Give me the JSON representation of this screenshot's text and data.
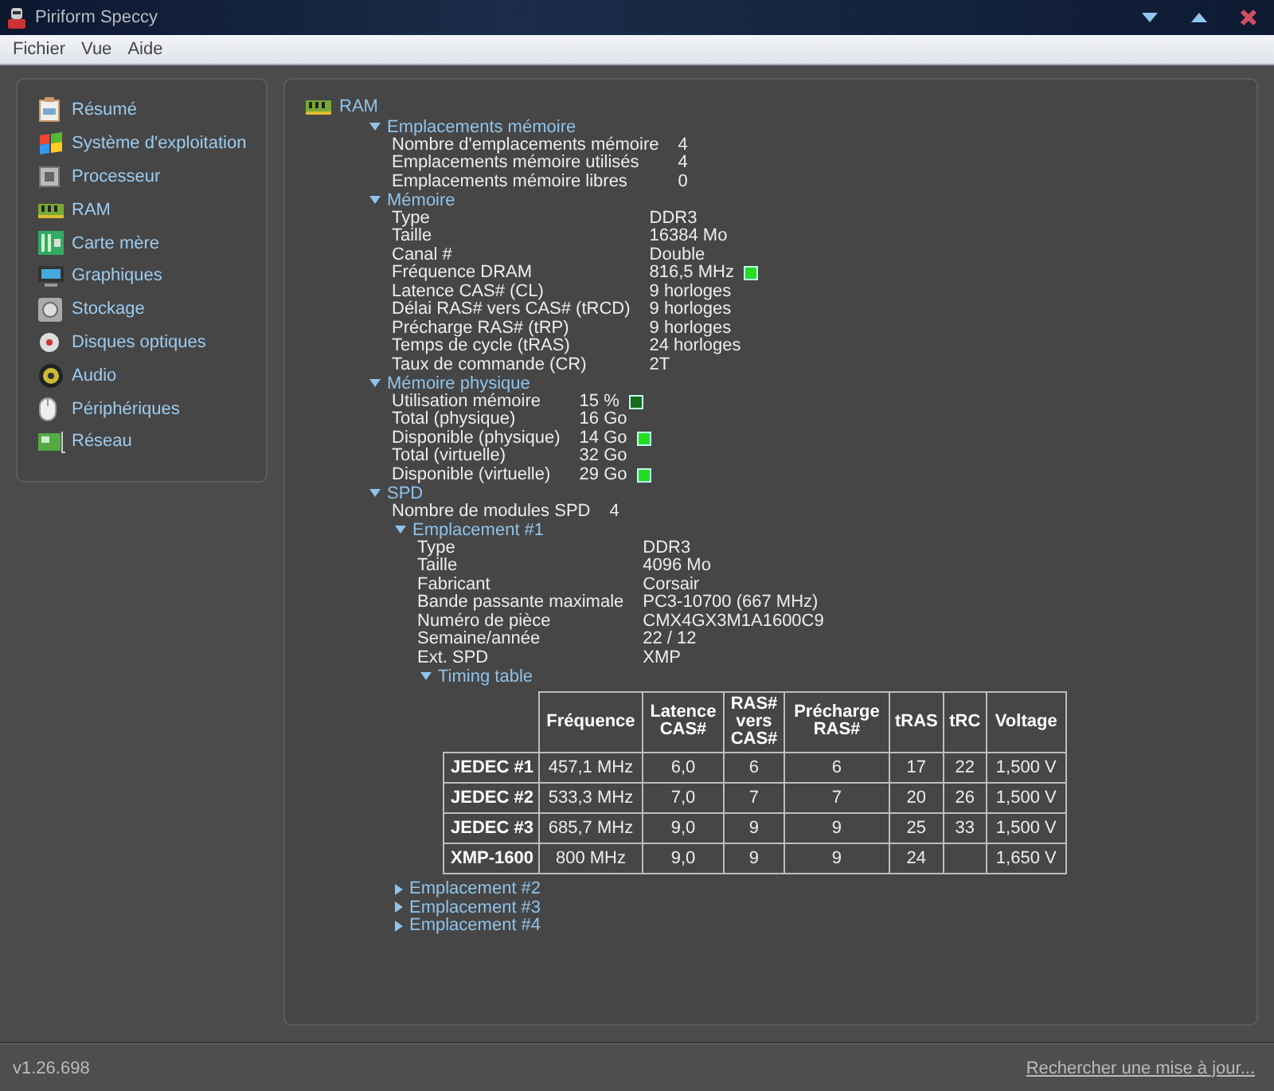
{
  "window": {
    "title": "Piriform Speccy"
  },
  "menu": [
    "Fichier",
    "Vue",
    "Aide"
  ],
  "sidebar": {
    "items": [
      "Résumé",
      "Système d'exploitation",
      "Processeur",
      "RAM",
      "Carte mère",
      "Graphiques",
      "Stockage",
      "Disques optiques",
      "Audio",
      "Périphériques",
      "Réseau"
    ]
  },
  "content": {
    "title": "RAM",
    "sections": [
      {
        "label": "Emplacements mémoire",
        "expanded": true,
        "rows": [
          {
            "label": "Nombre d'emplacements mémoire",
            "value": "4"
          },
          {
            "label": "Emplacements mémoire utilisés",
            "value": "4"
          },
          {
            "label": "Emplacements mémoire libres",
            "value": "0"
          }
        ]
      },
      {
        "label": "Mémoire",
        "expanded": true,
        "rows": [
          {
            "label": "Type",
            "value": "DDR3"
          },
          {
            "label": "Taille",
            "value": "16384 Mo"
          },
          {
            "label": "Canal #",
            "value": "Double"
          },
          {
            "label": "Fréquence DRAM",
            "value": "816,5 MHz",
            "color": "#22dd22"
          },
          {
            "label": "Latence CAS# (CL)",
            "value": "9 horloges"
          },
          {
            "label": "Délai RAS# vers CAS# (tRCD)",
            "value": "9 horloges"
          },
          {
            "label": "Précharge RAS# (tRP)",
            "value": "9 horloges"
          },
          {
            "label": "Temps de cycle (tRAS)",
            "value": "24 horloges"
          },
          {
            "label": "Taux de commande (CR)",
            "value": "2T"
          }
        ]
      },
      {
        "label": "Mémoire physique",
        "expanded": true,
        "rows": [
          {
            "label": "Utilisation mémoire",
            "value": "15 %",
            "color": "#1c6a1c"
          },
          {
            "label": "Total (physique)",
            "value": "16 Go"
          },
          {
            "label": "Disponible (physique)",
            "value": "14 Go",
            "color": "#22dd22"
          },
          {
            "label": "Total (virtuelle)",
            "value": "32 Go"
          },
          {
            "label": "Disponible (virtuelle)",
            "value": "29 Go",
            "color": "#22dd22"
          }
        ]
      },
      {
        "label": "SPD",
        "expanded": true,
        "rows": [
          {
            "label": "Nombre de modules SPD",
            "value": "4"
          }
        ],
        "children": [
          {
            "label": "Emplacement #1",
            "expanded": true,
            "rows": [
              {
                "label": "Type",
                "value": "DDR3"
              },
              {
                "label": "Taille",
                "value": "4096 Mo"
              },
              {
                "label": "Fabricant",
                "value": "Corsair"
              },
              {
                "label": "Bande passante maximale",
                "value": "PC3-10700 (667 MHz)"
              },
              {
                "label": "Numéro de pièce",
                "value": "CMX4GX3M1A1600C9"
              },
              {
                "label": "Semaine/année",
                "value": "22 / 12"
              },
              {
                "label": "Ext. SPD",
                "value": "XMP"
              }
            ],
            "children": [
              {
                "label": "Timing table",
                "expanded": true,
                "table": {
                  "columns": [
                    "Fréquence",
                    "Latence CAS#",
                    "RAS# vers CAS#",
                    "Précharge RAS#",
                    "tRAS",
                    "tRC",
                    "Voltage"
                  ],
                  "rows": [
                    {
                      "label": "JEDEC #1",
                      "cells": [
                        "457,1 MHz",
                        "6,0",
                        "6",
                        "6",
                        "17",
                        "22",
                        "1,500 V"
                      ]
                    },
                    {
                      "label": "JEDEC #2",
                      "cells": [
                        "533,3 MHz",
                        "7,0",
                        "7",
                        "7",
                        "20",
                        "26",
                        "1,500 V"
                      ]
                    },
                    {
                      "label": "JEDEC #3",
                      "cells": [
                        "685,7 MHz",
                        "9,0",
                        "9",
                        "9",
                        "25",
                        "33",
                        "1,500 V"
                      ]
                    },
                    {
                      "label": "XMP-1600",
                      "cells": [
                        "800 MHz",
                        "9,0",
                        "9",
                        "9",
                        "24",
                        null,
                        "1,650 V"
                      ]
                    }
                  ]
                }
              }
            ]
          },
          {
            "label": "Emplacement #2",
            "expanded": false
          },
          {
            "label": "Emplacement #3",
            "expanded": false
          },
          {
            "label": "Emplacement #4",
            "expanded": false
          }
        ]
      }
    ]
  },
  "status_bar": {
    "version": "v1.26.698",
    "update_link": "Rechercher une mise à jour..."
  }
}
